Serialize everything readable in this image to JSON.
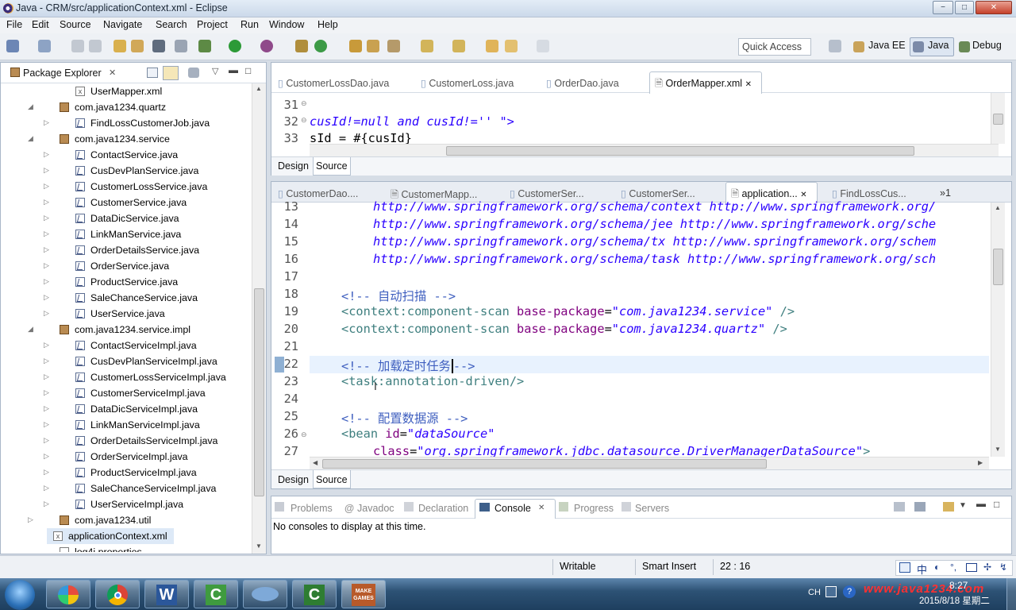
{
  "window": {
    "title": "Java - CRM/src/applicationContext.xml - Eclipse",
    "min": "−",
    "max": "□",
    "close": "✕"
  },
  "menu": [
    "File",
    "Edit",
    "Source",
    "Navigate",
    "Search",
    "Project",
    "Run",
    "Window",
    "Help"
  ],
  "toolbar": {
    "quick_access": "Quick Access",
    "perspectives": [
      "Java EE",
      "Java",
      "Debug"
    ]
  },
  "package_explorer": {
    "title": "Package Explorer",
    "rows": [
      {
        "label": "UserMapper.xml",
        "icon": "xml-file-icon",
        "indent": 2,
        "arrow": ""
      },
      {
        "label": "com.java1234.quartz",
        "icon": "package-icon",
        "indent": 1,
        "arrow": "◢"
      },
      {
        "label": "FindLossCustomerJob.java",
        "icon": "java-file-icon",
        "indent": 2,
        "arrow": "▷"
      },
      {
        "label": "com.java1234.service",
        "icon": "package-icon",
        "indent": 1,
        "arrow": "◢"
      },
      {
        "label": "ContactService.java",
        "icon": "java-file-icon",
        "indent": 2,
        "arrow": "▷"
      },
      {
        "label": "CusDevPlanService.java",
        "icon": "java-file-icon",
        "indent": 2,
        "arrow": "▷"
      },
      {
        "label": "CustomerLossService.java",
        "icon": "java-file-icon",
        "indent": 2,
        "arrow": "▷"
      },
      {
        "label": "CustomerService.java",
        "icon": "java-file-icon",
        "indent": 2,
        "arrow": "▷"
      },
      {
        "label": "DataDicService.java",
        "icon": "java-file-icon",
        "indent": 2,
        "arrow": "▷"
      },
      {
        "label": "LinkManService.java",
        "icon": "java-file-icon",
        "indent": 2,
        "arrow": "▷"
      },
      {
        "label": "OrderDetailsService.java",
        "icon": "java-file-icon",
        "indent": 2,
        "arrow": "▷"
      },
      {
        "label": "OrderService.java",
        "icon": "java-file-icon",
        "indent": 2,
        "arrow": "▷"
      },
      {
        "label": "ProductService.java",
        "icon": "java-file-icon",
        "indent": 2,
        "arrow": "▷"
      },
      {
        "label": "SaleChanceService.java",
        "icon": "java-file-icon",
        "indent": 2,
        "arrow": "▷"
      },
      {
        "label": "UserService.java",
        "icon": "java-file-icon",
        "indent": 2,
        "arrow": "▷"
      },
      {
        "label": "com.java1234.service.impl",
        "icon": "package-icon",
        "indent": 1,
        "arrow": "◢"
      },
      {
        "label": "ContactServiceImpl.java",
        "icon": "java-file-icon",
        "indent": 2,
        "arrow": "▷"
      },
      {
        "label": "CusDevPlanServiceImpl.java",
        "icon": "java-file-icon",
        "indent": 2,
        "arrow": "▷"
      },
      {
        "label": "CustomerLossServiceImpl.java",
        "icon": "java-file-icon",
        "indent": 2,
        "arrow": "▷"
      },
      {
        "label": "CustomerServiceImpl.java",
        "icon": "java-file-icon",
        "indent": 2,
        "arrow": "▷"
      },
      {
        "label": "DataDicServiceImpl.java",
        "icon": "java-file-icon",
        "indent": 2,
        "arrow": "▷"
      },
      {
        "label": "LinkManServiceImpl.java",
        "icon": "java-file-icon",
        "indent": 2,
        "arrow": "▷"
      },
      {
        "label": "OrderDetailsServiceImpl.java",
        "icon": "java-file-icon",
        "indent": 2,
        "arrow": "▷"
      },
      {
        "label": "OrderServiceImpl.java",
        "icon": "java-file-icon",
        "indent": 2,
        "arrow": "▷"
      },
      {
        "label": "ProductServiceImpl.java",
        "icon": "java-file-icon",
        "indent": 2,
        "arrow": "▷"
      },
      {
        "label": "SaleChanceServiceImpl.java",
        "icon": "java-file-icon",
        "indent": 2,
        "arrow": "▷"
      },
      {
        "label": "UserServiceImpl.java",
        "icon": "java-file-icon",
        "indent": 2,
        "arrow": "▷"
      },
      {
        "label": "com.java1234.util",
        "icon": "package-icon",
        "indent": 1,
        "arrow": "▷"
      },
      {
        "label": "applicationContext.xml",
        "icon": "xml-file-icon",
        "indent": 1,
        "arrow": "",
        "selected": true
      },
      {
        "label": "log4j.properties",
        "icon": "properties-file-icon",
        "indent": 1,
        "arrow": ""
      }
    ]
  },
  "top_editor": {
    "tabs": [
      "CustomerLossDao.java",
      "CustomerLoss.java",
      "OrderDao.java",
      "OrderMapper.xml"
    ],
    "active_tab": "OrderMapper.xml",
    "line_numbers": [
      "31",
      "32",
      "33"
    ],
    "lines": [
      "",
      "cusId!=null and cusId!='' \">",
      "sId = #{cusId}"
    ],
    "bottom_tabs": [
      "Design",
      "Source"
    ]
  },
  "bottom_editor": {
    "tabs": [
      "CustomerDao....",
      "CustomerMapp...",
      "CustomerSer...",
      "CustomerSer...",
      "application...",
      "FindLossCus..."
    ],
    "active_tab": "application...",
    "overflow": "»1",
    "line_numbers": [
      "13",
      "14",
      "15",
      "16",
      "17",
      "18",
      "19",
      "20",
      "21",
      "22",
      "23",
      "24",
      "25",
      "26",
      "27"
    ],
    "lines": {
      "l13": "http://www.springframework.org/schema/context http://www.springframework.org/",
      "l14": "http://www.springframework.org/schema/jee http://www.springframework.org/sche",
      "l15": "http://www.springframework.org/schema/tx http://www.springframework.org/schem",
      "l16": "http://www.springframework.org/schema/task http://www.springframework.org/sch",
      "l18_comment": "<!-- 自动扫描 -->",
      "l19_tag": "<context:component-scan",
      "l19_attr": "base-package",
      "l19_val": "\"com.java1234.service\"",
      "l19_end": "/>",
      "l20_tag": "<context:component-scan",
      "l20_attr": "base-package",
      "l20_val": "\"com.java1234.quartz\"",
      "l20_end": "/>",
      "l22_open": "<!-- 加载定时任务",
      "l22_close": "-->",
      "l23": "<task:annotation-driven/>",
      "l25_comment": "<!-- 配置数据源 -->",
      "l26_tag": "<bean",
      "l26_attr": "id",
      "l26_val": "\"dataSource\"",
      "l27_attr": "class",
      "l27_val": "\"org.springframework.jdbc.datasource.DriverManagerDataSource\"",
      "l27_end": ">"
    },
    "bottom_tabs": [
      "Design",
      "Source"
    ]
  },
  "console": {
    "tabs": [
      "Problems",
      "Javadoc",
      "Declaration",
      "Console",
      "Progress",
      "Servers"
    ],
    "active_tab": "Console",
    "message": "No consoles to display at this time."
  },
  "status": {
    "mode": "Writable",
    "insert": "Smart Insert",
    "position": "22 : 16"
  },
  "taskbar": {
    "lang": "CH",
    "ime": [
      "中"
    ],
    "time": "8:27",
    "date": "2015/8/18 星期二",
    "watermark": "www.java1234.com",
    "game_icon_text": "MAKE GAMES"
  },
  "colors": {
    "tag": "#3f7f7f",
    "attr": "#7f007f",
    "string": "#2a00ff",
    "comment": "#3f5fbf"
  }
}
